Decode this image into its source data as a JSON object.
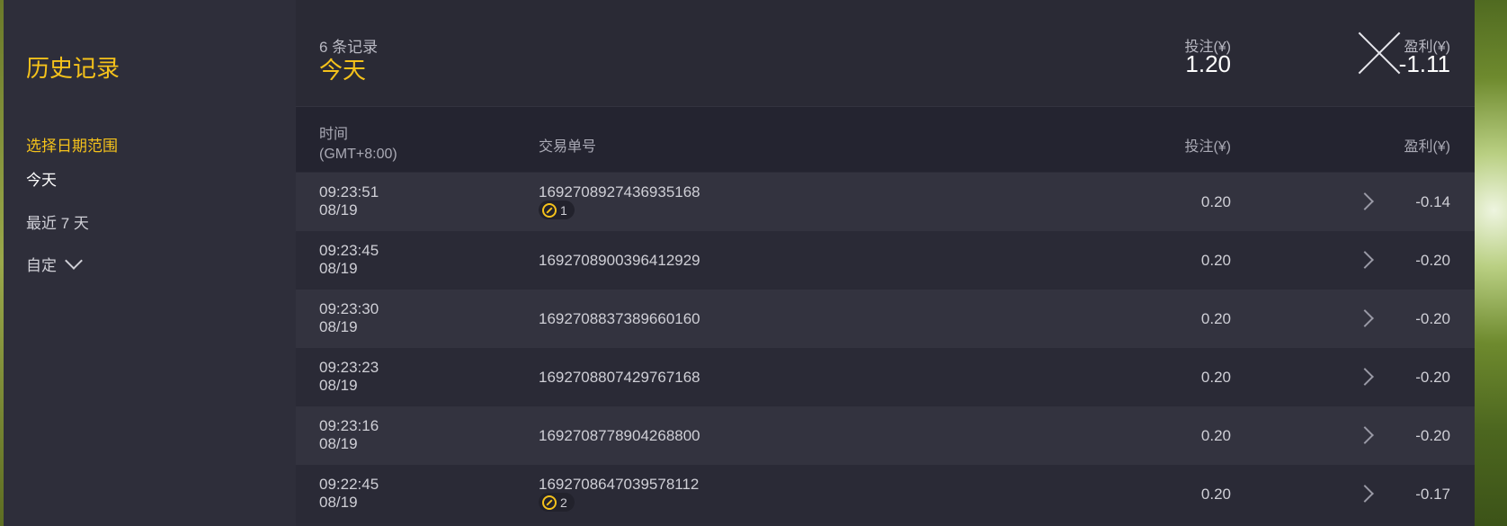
{
  "sidebar": {
    "title": "历史记录",
    "date_range_label": "选择日期范围",
    "items": [
      {
        "label": "今天",
        "active": true
      },
      {
        "label": "最近 7 天",
        "active": false
      },
      {
        "label": "自定",
        "active": false
      }
    ]
  },
  "summary": {
    "count": "6 条记录",
    "period": "今天",
    "stake_label": "投注(¥)",
    "stake_value": "1.20",
    "profit_label": "盈利(¥)",
    "profit_value": "-1.11"
  },
  "table": {
    "headers": {
      "time": "时间",
      "timezone": "(GMT+8:00)",
      "order_id": "交易单号",
      "stake": "投注(¥)",
      "profit": "盈利(¥)"
    },
    "rows": [
      {
        "time": "09:23:51",
        "date": "08/19",
        "order_id": "1692708927436935168",
        "badge": "1",
        "stake": "0.20",
        "profit": "-0.14"
      },
      {
        "time": "09:23:45",
        "date": "08/19",
        "order_id": "1692708900396412929",
        "badge": null,
        "stake": "0.20",
        "profit": "-0.20"
      },
      {
        "time": "09:23:30",
        "date": "08/19",
        "order_id": "1692708837389660160",
        "badge": null,
        "stake": "0.20",
        "profit": "-0.20"
      },
      {
        "time": "09:23:23",
        "date": "08/19",
        "order_id": "1692708807429767168",
        "badge": null,
        "stake": "0.20",
        "profit": "-0.20"
      },
      {
        "time": "09:23:16",
        "date": "08/19",
        "order_id": "1692708778904268800",
        "badge": null,
        "stake": "0.20",
        "profit": "-0.20"
      },
      {
        "time": "09:22:45",
        "date": "08/19",
        "order_id": "1692708647039578112",
        "badge": "2",
        "stake": "0.20",
        "profit": "-0.17"
      }
    ]
  },
  "colors": {
    "accent": "#f5c21b",
    "panel": "#2b2b37",
    "sidebar": "#2e2e3a"
  },
  "icons": {
    "close": "close-icon",
    "row_arrow": "chevron-right-icon",
    "dropdown": "chevron-down-icon",
    "badge": "coin-icon"
  }
}
